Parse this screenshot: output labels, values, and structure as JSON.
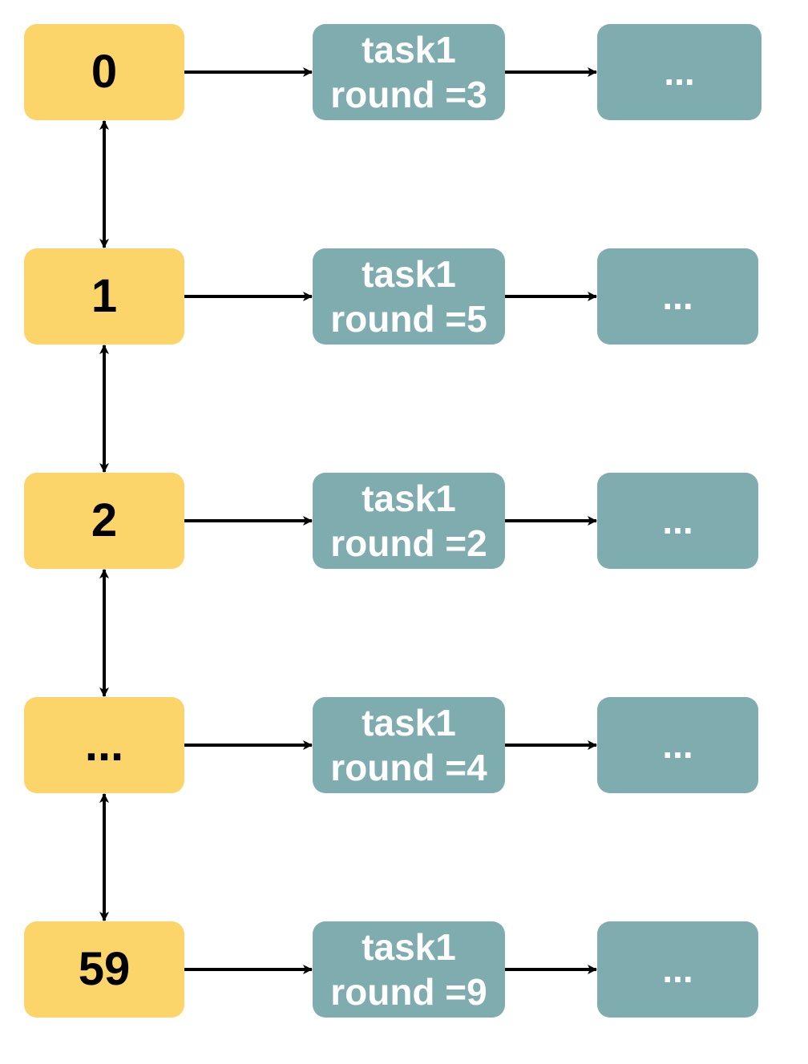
{
  "colors": {
    "slot_fill": "#FCD56A",
    "task_fill": "#7FACAF",
    "arrow": "#000000"
  },
  "slots": [
    {
      "label": "0",
      "task": {
        "name": "task1",
        "round": "round =3"
      },
      "next": "..."
    },
    {
      "label": "1",
      "task": {
        "name": "task1",
        "round": "round =5"
      },
      "next": "..."
    },
    {
      "label": "2",
      "task": {
        "name": "task1",
        "round": "round =2"
      },
      "next": "..."
    },
    {
      "label": "...",
      "task": {
        "name": "task1",
        "round": "round =4"
      },
      "next": "..."
    },
    {
      "label": "59",
      "task": {
        "name": "task1",
        "round": "round =9"
      },
      "next": "..."
    }
  ]
}
